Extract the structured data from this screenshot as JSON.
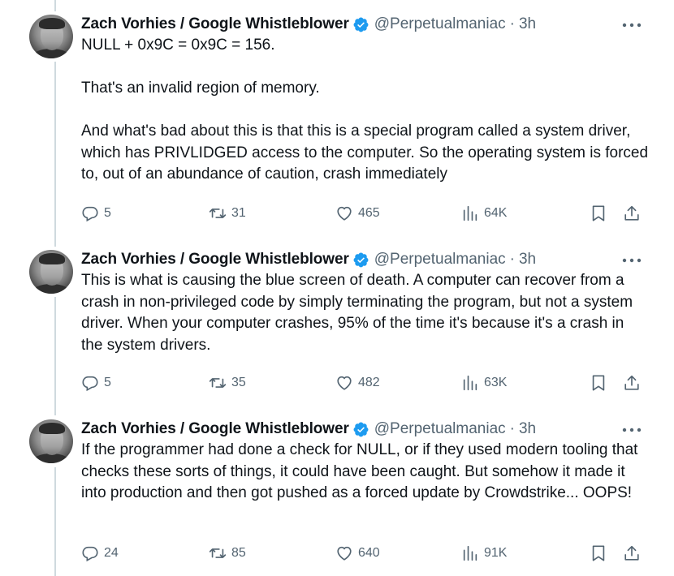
{
  "tweets": [
    {
      "author": "Zach Vorhies / Google Whistleblower",
      "handle": "@Perpetualmaniac",
      "separator": "·",
      "time": "3h",
      "paragraphs": [
        "NULL + 0x9C = 0x9C = 156.",
        "That's an invalid region of memory.",
        "And what's bad about this is that this is a special program called a system driver, which has PRIVLIDGED access to the computer. So the operating system is forced to, out of an abundance of caution, crash immediately"
      ],
      "replies": "5",
      "reposts": "31",
      "likes": "465",
      "views": "64K"
    },
    {
      "author": "Zach Vorhies / Google Whistleblower",
      "handle": "@Perpetualmaniac",
      "separator": "·",
      "time": "3h",
      "paragraphs": [
        "This is what is causing the blue screen of death. A computer can recover from a crash in non-privileged code by simply terminating the program, but not a system driver. When your computer crashes, 95% of the time it's because it's a crash in the system drivers."
      ],
      "replies": "5",
      "reposts": "35",
      "likes": "482",
      "views": "63K"
    },
    {
      "author": "Zach Vorhies / Google Whistleblower",
      "handle": "@Perpetualmaniac",
      "separator": "·",
      "time": "3h",
      "paragraphs": [
        "If the programmer had done a check for NULL, or if they used modern tooling that checks these sorts of things, it could have been caught. But somehow it made it into production and then got pushed as a forced update by Crowdstrike... OOPS!"
      ],
      "replies": "24",
      "reposts": "85",
      "likes": "640",
      "views": "91K"
    }
  ],
  "icons": {
    "verified": "verified-badge-icon",
    "more": "more-icon",
    "reply": "reply-icon",
    "repost": "repost-icon",
    "like": "like-icon",
    "views": "views-icon",
    "bookmark": "bookmark-icon",
    "share": "share-icon"
  },
  "colors": {
    "verified": "#1d9bf0",
    "text": "#0f1419",
    "secondary": "#536471",
    "thread_line": "#cfd9de"
  }
}
